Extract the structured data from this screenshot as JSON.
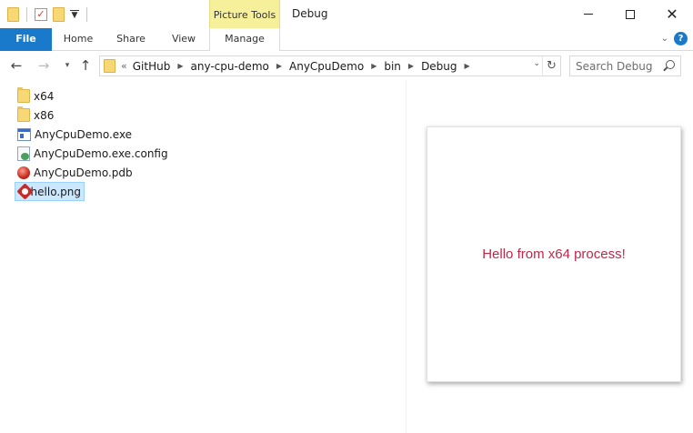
{
  "window": {
    "title": "Debug",
    "contextual_group": "Picture Tools"
  },
  "ribbon": {
    "tabs": [
      {
        "label": "File"
      },
      {
        "label": "Home"
      },
      {
        "label": "Share"
      },
      {
        "label": "View"
      },
      {
        "label": "Manage"
      }
    ],
    "help_label": "?"
  },
  "address": {
    "lead": "«",
    "crumbs": [
      "GitHub",
      "any-cpu-demo",
      "AnyCpuDemo",
      "bin",
      "Debug"
    ]
  },
  "search": {
    "placeholder": "Search Debug"
  },
  "files": [
    {
      "name": "x64",
      "icon": "folder-icon"
    },
    {
      "name": "x86",
      "icon": "folder-icon"
    },
    {
      "name": "AnyCpuDemo.exe",
      "icon": "exe-icon"
    },
    {
      "name": "AnyCpuDemo.exe.config",
      "icon": "config-file-icon"
    },
    {
      "name": "AnyCpuDemo.pdb",
      "icon": "pdb-file-icon"
    },
    {
      "name": "hello.png",
      "icon": "png-image-icon",
      "selected": true
    }
  ],
  "preview": {
    "text": "Hello from x64 process!",
    "text_color": "#c0284a"
  },
  "colors": {
    "accent": "#1979ca",
    "contextual_tab": "#f7f09b",
    "selection": "#cce8ff"
  }
}
